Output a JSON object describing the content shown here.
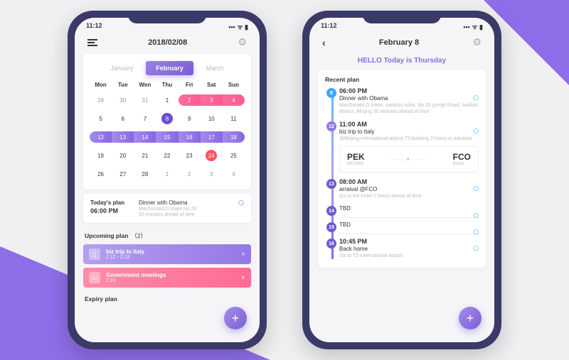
{
  "status_time": "11:12",
  "left": {
    "header_title": "2018/02/08",
    "month_tabs": [
      "January",
      "February",
      "March"
    ],
    "active_month": "February",
    "day_labels": [
      "Mon",
      "Tue",
      "Wen",
      "Thu",
      "Fri",
      "Sat",
      "Sun"
    ],
    "today_plan": {
      "label": "Today's plan",
      "time": "06:00 PM",
      "title": "Dinner with Obama",
      "sub1": "MacDonald,D tower,No.26",
      "sub2": "30 minutes ahead of time"
    },
    "upcoming": {
      "label": "Upcoming plan",
      "count": "（2）"
    },
    "tiles": [
      {
        "title": "biz trip to Italy",
        "date": "2.12 - 2.19"
      },
      {
        "title": "Government meetings",
        "date": "2.24"
      }
    ],
    "expiry_label": "Expiry plan"
  },
  "right": {
    "header_title": "February 8",
    "hello": "HELLO Today is Thursday",
    "recent_label": "Recent plan",
    "items": [
      {
        "day": "8",
        "color": "blue",
        "time": "06:00 PM",
        "title": "Dinner with Obama",
        "sub": "MacDonald,D tower, sanlitun soho, No.26 gongti Road, haidian district, BEijing\n30 minutes ahead of time"
      },
      {
        "day": "12",
        "color": "purple",
        "time": "11:00 AM",
        "title": "biz trip to Italy",
        "sub": "@Beijing international airport T3 building\n2 hours in advance",
        "ticket": {
          "from": "PEK",
          "from_sub": "BEIJING",
          "to": "FCO",
          "to_sub": "Rome"
        }
      },
      {
        "day": "13",
        "color": "dark",
        "time": "08:00 AM",
        "title": "arraival @FCO",
        "sub": "Go to the hotel\n1 hours ahead of time"
      },
      {
        "day": "14",
        "color": "dark",
        "time": "",
        "title": "TBD",
        "sub": ""
      },
      {
        "day": "15",
        "color": "dark",
        "time": "",
        "title": "TBD",
        "sub": ""
      },
      {
        "day": "16",
        "color": "dark",
        "time": "10:45 PM",
        "title": "Back home",
        "sub": "Go to T3 International Airport"
      }
    ]
  },
  "cal": [
    [
      {
        "n": "29"
      },
      {
        "n": "30"
      },
      {
        "n": "31"
      },
      {
        "n": "1",
        "in": 1
      },
      {
        "n": "2",
        "in": 1,
        "pill": "pink",
        "pos": "l"
      },
      {
        "n": "3",
        "in": 1,
        "pill": "pink",
        "pos": "m"
      },
      {
        "n": "4",
        "in": 1,
        "pill": "pink",
        "pos": "r"
      }
    ],
    [
      {
        "n": "5",
        "in": 1
      },
      {
        "n": "6",
        "in": 1
      },
      {
        "n": "7",
        "in": 1
      },
      {
        "n": "8",
        "in": 1,
        "sel": 1
      },
      {
        "n": "9",
        "in": 1
      },
      {
        "n": "10",
        "in": 1
      },
      {
        "n": "11",
        "in": 1
      }
    ],
    [
      {
        "n": "12",
        "in": 1,
        "pill": "purple",
        "pos": "l"
      },
      {
        "n": "13",
        "in": 1,
        "pill": "purple",
        "pos": "m"
      },
      {
        "n": "14",
        "in": 1,
        "pill": "purple",
        "pos": "m"
      },
      {
        "n": "15",
        "in": 1,
        "pill": "purple",
        "pos": "m"
      },
      {
        "n": "16",
        "in": 1,
        "pill": "purple",
        "pos": "m"
      },
      {
        "n": "17",
        "in": 1,
        "pill": "purple",
        "pos": "m"
      },
      {
        "n": "18",
        "in": 1,
        "pill": "purple",
        "pos": "r"
      }
    ],
    [
      {
        "n": "19",
        "in": 1
      },
      {
        "n": "20",
        "in": 1
      },
      {
        "n": "21",
        "in": 1
      },
      {
        "n": "22",
        "in": 1
      },
      {
        "n": "23",
        "in": 1
      },
      {
        "n": "24",
        "in": 1,
        "red": 1
      },
      {
        "n": "25",
        "in": 1
      }
    ],
    [
      {
        "n": "26",
        "in": 1
      },
      {
        "n": "27",
        "in": 1
      },
      {
        "n": "28",
        "in": 1
      },
      {
        "n": "1"
      },
      {
        "n": "2"
      },
      {
        "n": "3"
      },
      {
        "n": "4"
      }
    ]
  ]
}
